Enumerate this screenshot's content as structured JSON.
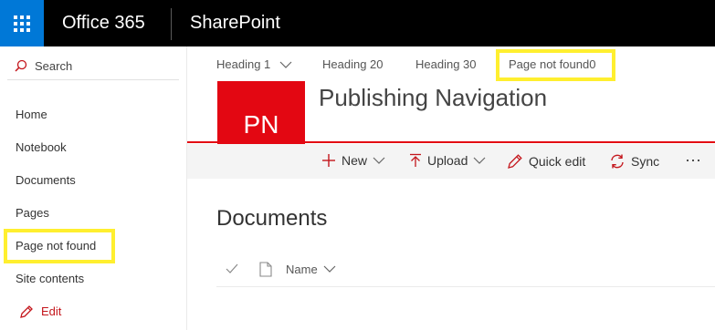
{
  "suite": {
    "product": "Office 365",
    "app": "SharePoint"
  },
  "leftnav": {
    "search_label": "Search",
    "items": [
      {
        "label": "Home"
      },
      {
        "label": "Notebook"
      },
      {
        "label": "Documents"
      },
      {
        "label": "Pages"
      },
      {
        "label": "Page not found"
      },
      {
        "label": "Site contents"
      }
    ],
    "edit_label": "Edit"
  },
  "topnav": {
    "items": [
      {
        "label": "Heading 1"
      },
      {
        "label": "Heading 20"
      },
      {
        "label": "Heading 30"
      },
      {
        "label": "Page not found0"
      }
    ]
  },
  "site": {
    "logo_text": "PN",
    "title": "Publishing Navigation"
  },
  "commandbar": {
    "new_label": "New",
    "upload_label": "Upload",
    "quickedit_label": "Quick edit",
    "sync_label": "Sync",
    "more_label": "···"
  },
  "library": {
    "title": "Documents",
    "name_column": "Name"
  },
  "colors": {
    "suitebar": "#000000",
    "waffle": "#0078d7",
    "brand_red": "#e30712",
    "highlight": "#ffef2f"
  },
  "icons": [
    "waffle-icon",
    "search-icon",
    "edit-icon",
    "chevron-down-icon",
    "plus-icon",
    "upload-icon",
    "pencil-icon",
    "sync-icon",
    "checkmark-icon",
    "file-icon"
  ]
}
